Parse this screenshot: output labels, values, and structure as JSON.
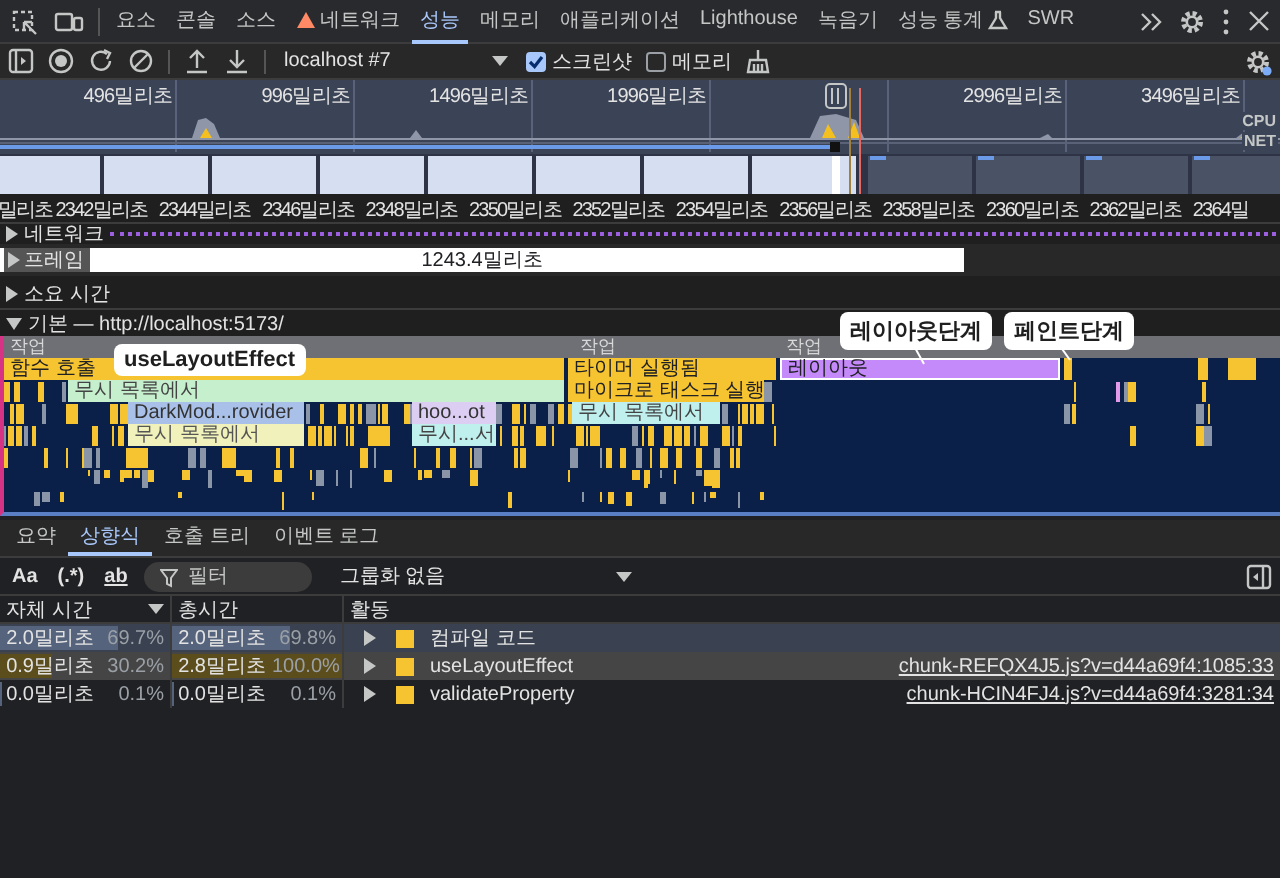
{
  "tabs": [
    {
      "label": "요소",
      "selected": false,
      "warning": false,
      "experimental": false
    },
    {
      "label": "콘솔",
      "selected": false,
      "warning": false,
      "experimental": false
    },
    {
      "label": "소스",
      "selected": false,
      "warning": false,
      "experimental": false
    },
    {
      "label": "네트워크",
      "selected": false,
      "warning": true,
      "experimental": false
    },
    {
      "label": "성능",
      "selected": true,
      "warning": false,
      "experimental": false
    },
    {
      "label": "메모리",
      "selected": false,
      "warning": false,
      "experimental": false
    },
    {
      "label": "애플리케이션",
      "selected": false,
      "warning": false,
      "experimental": false
    },
    {
      "label": "Lighthouse",
      "selected": false,
      "warning": false,
      "experimental": false
    },
    {
      "label": "녹음기",
      "selected": false,
      "warning": false,
      "experimental": false
    },
    {
      "label": "성능 통계",
      "selected": false,
      "warning": false,
      "experimental": true
    },
    {
      "label": "SWR",
      "selected": false,
      "warning": false,
      "experimental": false
    }
  ],
  "toolbar": {
    "recording": "localhost #7",
    "options": [
      {
        "label": "스크린샷",
        "checked": true
      },
      {
        "label": "메모리",
        "checked": false
      }
    ]
  },
  "overview": {
    "ticks": [
      "496밀리초",
      "996밀리초",
      "1496밀리초",
      "1996밀리초",
      "2996밀리초",
      "3496밀리초"
    ],
    "cpu_label": "CPU",
    "net_label": "NET"
  },
  "ruler": [
    "밀리초",
    "2342밀리초",
    "2344밀리초",
    "2346밀리초",
    "2348밀리초",
    "2350밀리초",
    "2352밀리초",
    "2354밀리초",
    "2356밀리초",
    "2358밀리초",
    "2360밀리초",
    "2362밀리초",
    "2364밀"
  ],
  "tracks": {
    "network": "네트워크",
    "frames": {
      "label": "프레임",
      "duration": "1243.4밀리초"
    },
    "timings": "소요 시간",
    "main": "기본 — http://localhost:5173/"
  },
  "flame": [
    {
      "label": "작업",
      "kind": "task"
    },
    {
      "label": "작업",
      "kind": "task"
    },
    {
      "label": "작업",
      "kind": "task"
    },
    {
      "label": "함수 호출",
      "kind": "script"
    },
    {
      "label": "타이머 실행됨",
      "kind": "script"
    },
    {
      "label": "레이아웃",
      "kind": "layout"
    },
    {
      "label": "무시 목록에서",
      "kind": "ignored"
    },
    {
      "label": "마이크로 태스크 실행",
      "kind": "script"
    },
    {
      "label": "DarkMod...rovider",
      "kind": "component"
    },
    {
      "label": "hoo...ot",
      "kind": "hook"
    },
    {
      "label": "무시 목록에서",
      "kind": "ignored-alt"
    },
    {
      "label": "무시 목록에서",
      "kind": "ignored-pale"
    },
    {
      "label": "무시...서",
      "kind": "ignored-alt"
    }
  ],
  "callouts": [
    {
      "text": "useLayoutEffect"
    },
    {
      "text": "레이아웃단계"
    },
    {
      "text": "페인트단계"
    }
  ],
  "bottom_tabs": [
    {
      "label": "요약",
      "selected": false
    },
    {
      "label": "상향식",
      "selected": true
    },
    {
      "label": "호출 트리",
      "selected": false
    },
    {
      "label": "이벤트 로그",
      "selected": false
    }
  ],
  "filter_bar": {
    "toggles": [
      "Aa",
      "(.*)",
      "ab"
    ],
    "placeholder": "필터",
    "grouping": "그룹화 없음"
  },
  "table": {
    "columns": [
      "자체 시간",
      "총시간",
      "활동"
    ],
    "rows": [
      {
        "self": {
          "time": "2.0밀리초",
          "percent": "69.7%",
          "level": 0.697
        },
        "total": {
          "time": "2.0밀리초",
          "percent": "69.8%",
          "level": 0.698
        },
        "name": "컴파일 코드",
        "source": "",
        "selected": false,
        "hovered": true
      },
      {
        "self": {
          "time": "0.9밀리초",
          "percent": "30.2%",
          "level": 0.302
        },
        "total": {
          "time": "2.8밀리초",
          "percent": "100.0%",
          "level": 1.0
        },
        "name": "useLayoutEffect",
        "source": "chunk-REFQX4J5.js?v=d44a69f4:1085:33",
        "selected": true,
        "hovered": false
      },
      {
        "self": {
          "time": "0.0밀리초",
          "percent": "0.1%",
          "level": 0.001
        },
        "total": {
          "time": "0.0밀리초",
          "percent": "0.1%",
          "level": 0.001
        },
        "name": "validateProperty",
        "source": "chunk-HCIN4FJ4.js?v=d44a69f4:3281:34",
        "selected": false,
        "hovered": false
      }
    ]
  }
}
